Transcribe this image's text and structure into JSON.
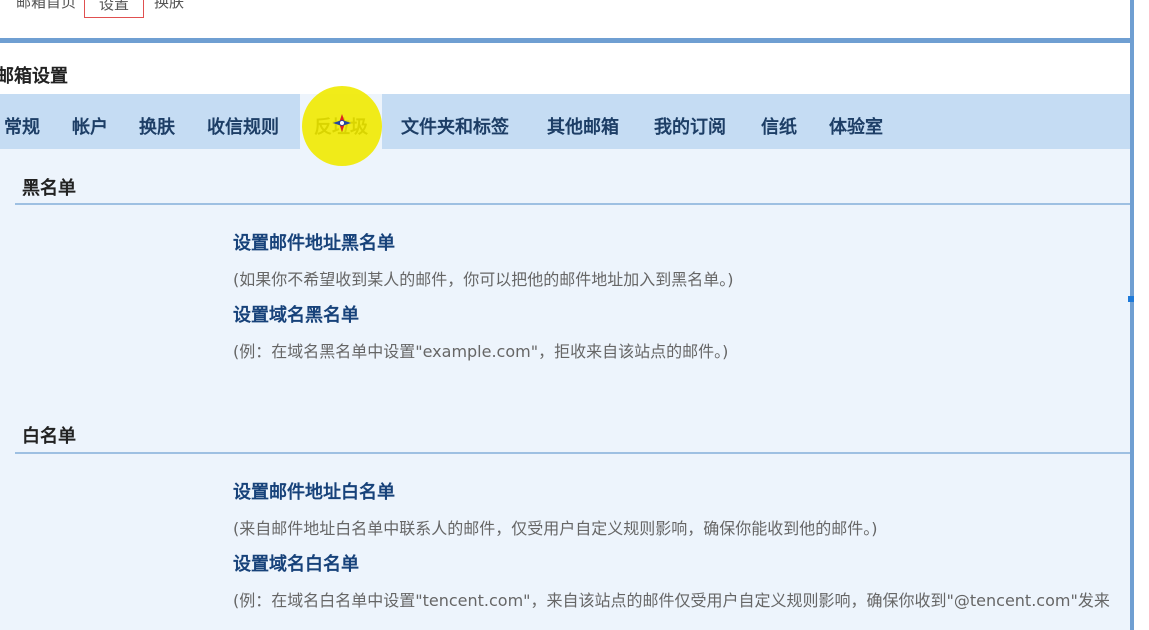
{
  "topnav": {
    "item1": "邮箱首页",
    "item2": "设置",
    "item3": "换肤"
  },
  "page_title": "邮箱设置",
  "tabs": [
    {
      "label": "常规"
    },
    {
      "label": "帐户"
    },
    {
      "label": "换肤"
    },
    {
      "label": "收信规则"
    },
    {
      "label": "反垃圾",
      "active": true
    },
    {
      "label": "文件夹和标签"
    },
    {
      "label": "其他邮箱"
    },
    {
      "label": "我的订阅"
    },
    {
      "label": "信纸"
    },
    {
      "label": "体验室"
    }
  ],
  "blacklist": {
    "title": "黑名单",
    "address_link": "设置邮件地址黑名单",
    "address_desc": "(如果你不希望收到某人的邮件，你可以把他的邮件地址加入到黑名单。)",
    "domain_link": "设置域名黑名单",
    "domain_desc": "(例：在域名黑名单中设置\"example.com\"，拒收来自该站点的邮件。)"
  },
  "whitelist": {
    "title": "白名单",
    "address_link": "设置邮件地址白名单",
    "address_desc": "(来自邮件地址白名单中联系人的邮件，仅受用户自定义规则影响，确保你能收到他的邮件。)",
    "domain_link": "设置域名白名单",
    "domain_desc": "(例：在域名白名单中设置\"tencent.com\"，来自该站点的邮件仅受用户自定义规则影响，确保你收到\"@tencent.com\"发来"
  },
  "colors": {
    "accent": "#6f9fd2",
    "tabbar": "#c5dcf3",
    "content_bg": "#edf4fc",
    "link": "#17427a",
    "cursor_highlight": "#f0ea00"
  }
}
